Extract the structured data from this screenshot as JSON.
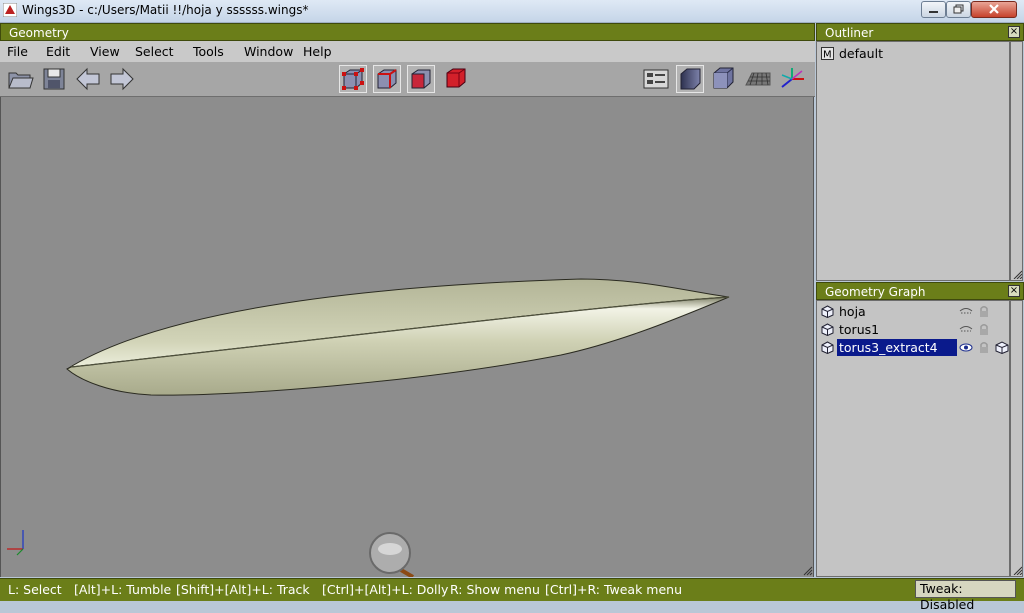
{
  "window": {
    "title": "Wings3D - c:/Users/Matii !!/hoja y ssssss.wings*"
  },
  "geometry": {
    "header": "Geometry",
    "menu": [
      "File",
      "Edit",
      "View",
      "Select",
      "Tools",
      "Window",
      "Help"
    ],
    "toolbar_left": [
      "open-folder-icon",
      "save-disk-icon",
      "undo-arrow-icon",
      "redo-arrow-icon"
    ],
    "toolbar_center": [
      "vertex-select-icon",
      "edge-select-icon",
      "face-select-icon",
      "body-select-icon"
    ],
    "toolbar_right": [
      "groundplane-toggle-icon",
      "smooth-shading-icon",
      "flat-shading-icon",
      "ground-grid-icon",
      "axes-icon"
    ]
  },
  "outliner": {
    "header": "Outliner",
    "items": [
      {
        "icon": "material-m-icon",
        "label": "default"
      }
    ]
  },
  "geometry_graph": {
    "header": "Geometry Graph",
    "items": [
      {
        "label": "hoja",
        "visible": false,
        "selected": false
      },
      {
        "label": "torus1",
        "visible": false,
        "selected": false
      },
      {
        "label": "torus3_extract4",
        "visible": true,
        "selected": true
      }
    ]
  },
  "status": {
    "hints": [
      "L: Select",
      "[Alt]+L: Tumble",
      "[Shift]+[Alt]+L: Track",
      "[Ctrl]+[Alt]+L: Dolly",
      "R: Show menu",
      "[Ctrl]+R: Tweak menu"
    ],
    "tweak": "Tweak: Disabled"
  },
  "colors": {
    "panel_header": "#6b7e19",
    "viewport_bg": "#8d8d8d",
    "selection": "#0a1a8c",
    "leaf": "#c3c5a6"
  }
}
